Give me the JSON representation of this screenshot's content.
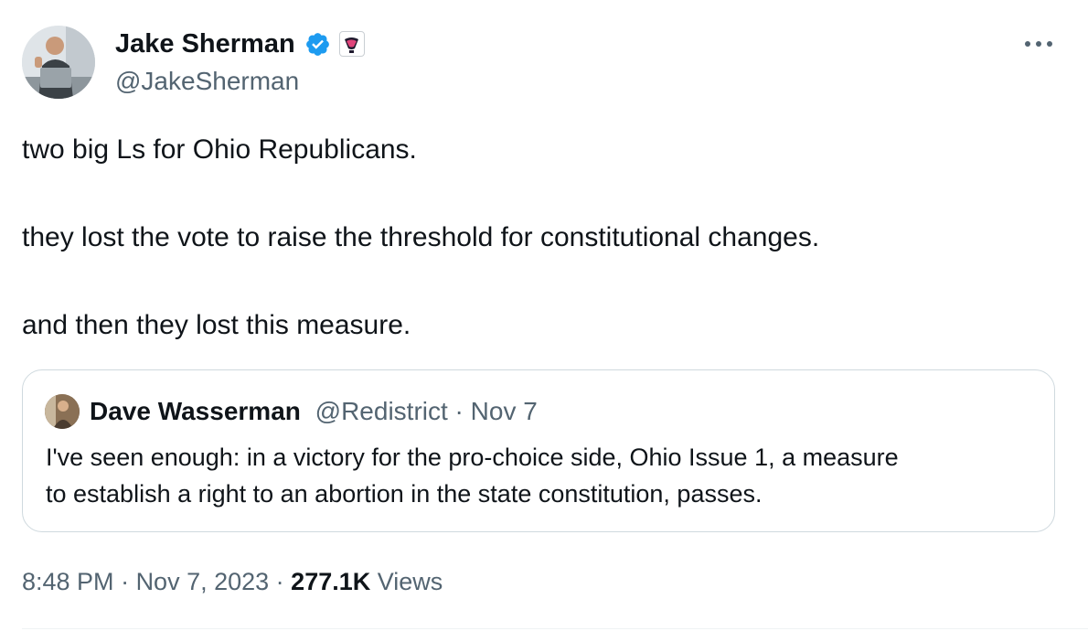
{
  "author": {
    "name": "Jake Sherman",
    "handle": "@JakeSherman",
    "verified_color": "#1d9bf0"
  },
  "tweet": {
    "lines": [
      "two big Ls for Ohio Republicans.",
      "they lost the vote to raise the threshold for constitutional changes.",
      "and then they lost this measure."
    ]
  },
  "quoted_tweet": {
    "name": "Dave Wasserman",
    "handle": "@Redistrict",
    "separator": " · ",
    "date": "Nov 7",
    "lines": [
      "I've seen enough: in a victory for the pro-choice side, Ohio Issue 1, a measure",
      "to establish a right to an abortion in the state constitution, passes."
    ]
  },
  "footer": {
    "time": "8:48 PM",
    "separator": " · ",
    "date": "Nov 7, 2023",
    "views_count": "277.1K",
    "views_label": " Views"
  },
  "colors": {
    "text": "#0f1419",
    "secondary": "#536471",
    "border": "#cfd9de"
  }
}
